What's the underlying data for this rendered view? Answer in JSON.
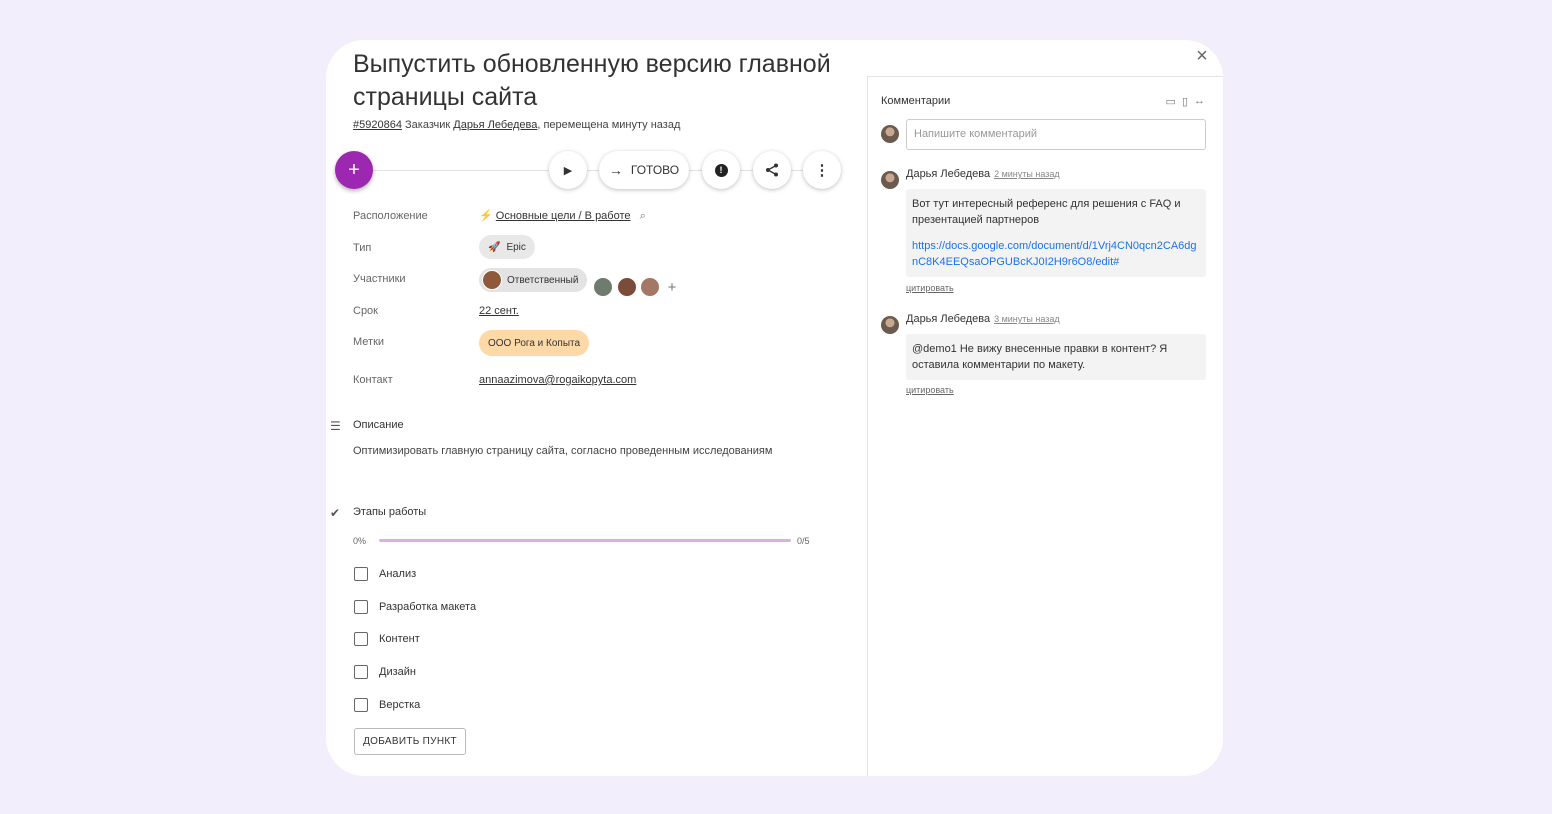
{
  "task": {
    "close_label": "×",
    "title": "Выпустить обновленную версию главной страницы сайта",
    "id": "#5920864",
    "customer_prefix": " Заказчик ",
    "customer": "Дарья Лебедева",
    "moved": ", перемещена минуту назад"
  },
  "toolbar": {
    "add_label": "+",
    "play_icon": "▶",
    "done_arrow": "→",
    "done_label": "ГОТОВО",
    "alert_icon": "!",
    "share_icon": "share",
    "more_icon": "⋮"
  },
  "properties": {
    "location_label": "Расположение",
    "location_value": "Основные цели / В работе",
    "type_label": "Тип",
    "type_value": "Epic",
    "participants_label": "Участники",
    "responsible_label": "Ответственный",
    "add_participant": "+",
    "due_label": "Срок",
    "due_value": "22 сент.",
    "tags_label": "Метки",
    "tag_value": "ООО Рога и Копыта",
    "contact_label": "Контакт",
    "contact_value": "annaazimova@rogaikopyta.com"
  },
  "description": {
    "title": "Описание",
    "text": "Оптимизировать главную страницу сайта, согласно проведенным исследованиям"
  },
  "stages": {
    "title": "Этапы работы",
    "progress_percent": "0%",
    "progress_count": "0/5",
    "progress_fraction": 0,
    "items": [
      "Анализ",
      "Разработка макета",
      "Контент",
      "Дизайн",
      "Верстка"
    ],
    "add_label": "ДОБАВИТЬ ПУНКТ"
  },
  "comments": {
    "title": "Комментарии",
    "input_placeholder": "Напишите комментарий",
    "list": [
      {
        "author": "Дарья Лебедева",
        "time": "2 минуты назад",
        "text": "Вот тут интересный референс для решения с FAQ и презентацией партнеров",
        "link": "https://docs.google.com/document/d/1Vrj4CN0qcn2CA6dgnC8K4EEQsaOPGUBcKJ0I2H9r6O8/edit#",
        "quote": "цитировать"
      },
      {
        "author": "Дарья Лебедева",
        "time": "3 минуты назад",
        "text": "@demo1 Не вижу внесенные правки в контент? Я оставила комментарии по макету.",
        "quote": "цитировать"
      }
    ]
  },
  "colors": {
    "accent": "#9c27b0",
    "background": "#f3eefb",
    "tag_bg": "#fdd9a8",
    "progress": "#d9b0e0"
  }
}
